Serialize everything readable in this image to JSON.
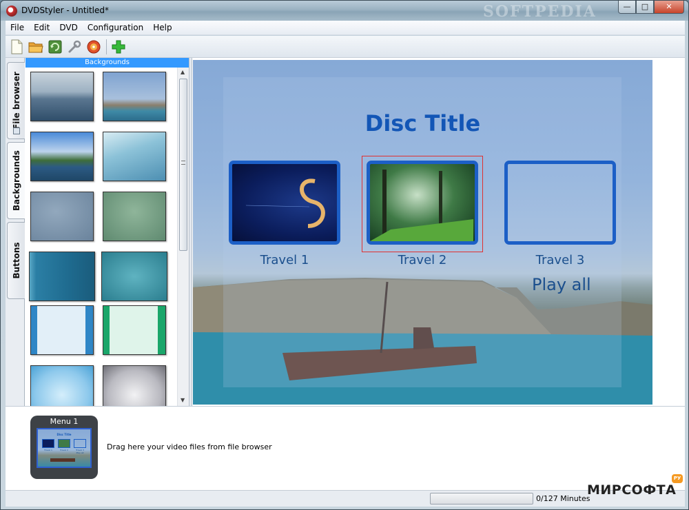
{
  "window": {
    "title": "DVDStyler - Untitled*",
    "watermark": "SOFTPEDIA",
    "controls": {
      "minimize": "—",
      "maximize": "□",
      "close": "✕"
    }
  },
  "menubar": {
    "items": [
      "File",
      "Edit",
      "DVD",
      "Configuration",
      "Help"
    ]
  },
  "toolbar": {
    "buttons": [
      {
        "icon": "new-document-icon"
      },
      {
        "icon": "open-folder-icon"
      },
      {
        "icon": "save-icon"
      },
      {
        "icon": "settings-wrench-icon"
      },
      {
        "icon": "burn-dvd-icon"
      },
      {
        "icon": "add-plus-icon"
      }
    ]
  },
  "sidebar": {
    "tabs": [
      "File browser",
      "Backgrounds",
      "Buttons"
    ],
    "active_tab": "Backgrounds",
    "panel_header": "Backgrounds"
  },
  "menu_canvas": {
    "title": "Disc Title",
    "buttons": [
      "Travel 1",
      "Travel 2",
      "Travel 3"
    ],
    "play_all": "Play all",
    "selected_button": "Travel 2",
    "title_color": "#1356b6",
    "label_color": "#1b4f8d",
    "frame_color": "#1c5fc6"
  },
  "titleset": {
    "menu_label": "Menu 1",
    "mini": {
      "title": "Disc Title",
      "labels": [
        "Travel 1",
        "Travel 2",
        "Travel 3"
      ],
      "play_all": "Play all"
    },
    "hint": "Drag here your video files from file browser"
  },
  "statusbar": {
    "progress": 0,
    "minutes": "0/127 Minutes"
  },
  "branding": {
    "text": "МИРСОФТА",
    "badge": "РУ"
  },
  "colors": {
    "selection_header": "#3399ff",
    "selection_rect": "#e0302f"
  }
}
